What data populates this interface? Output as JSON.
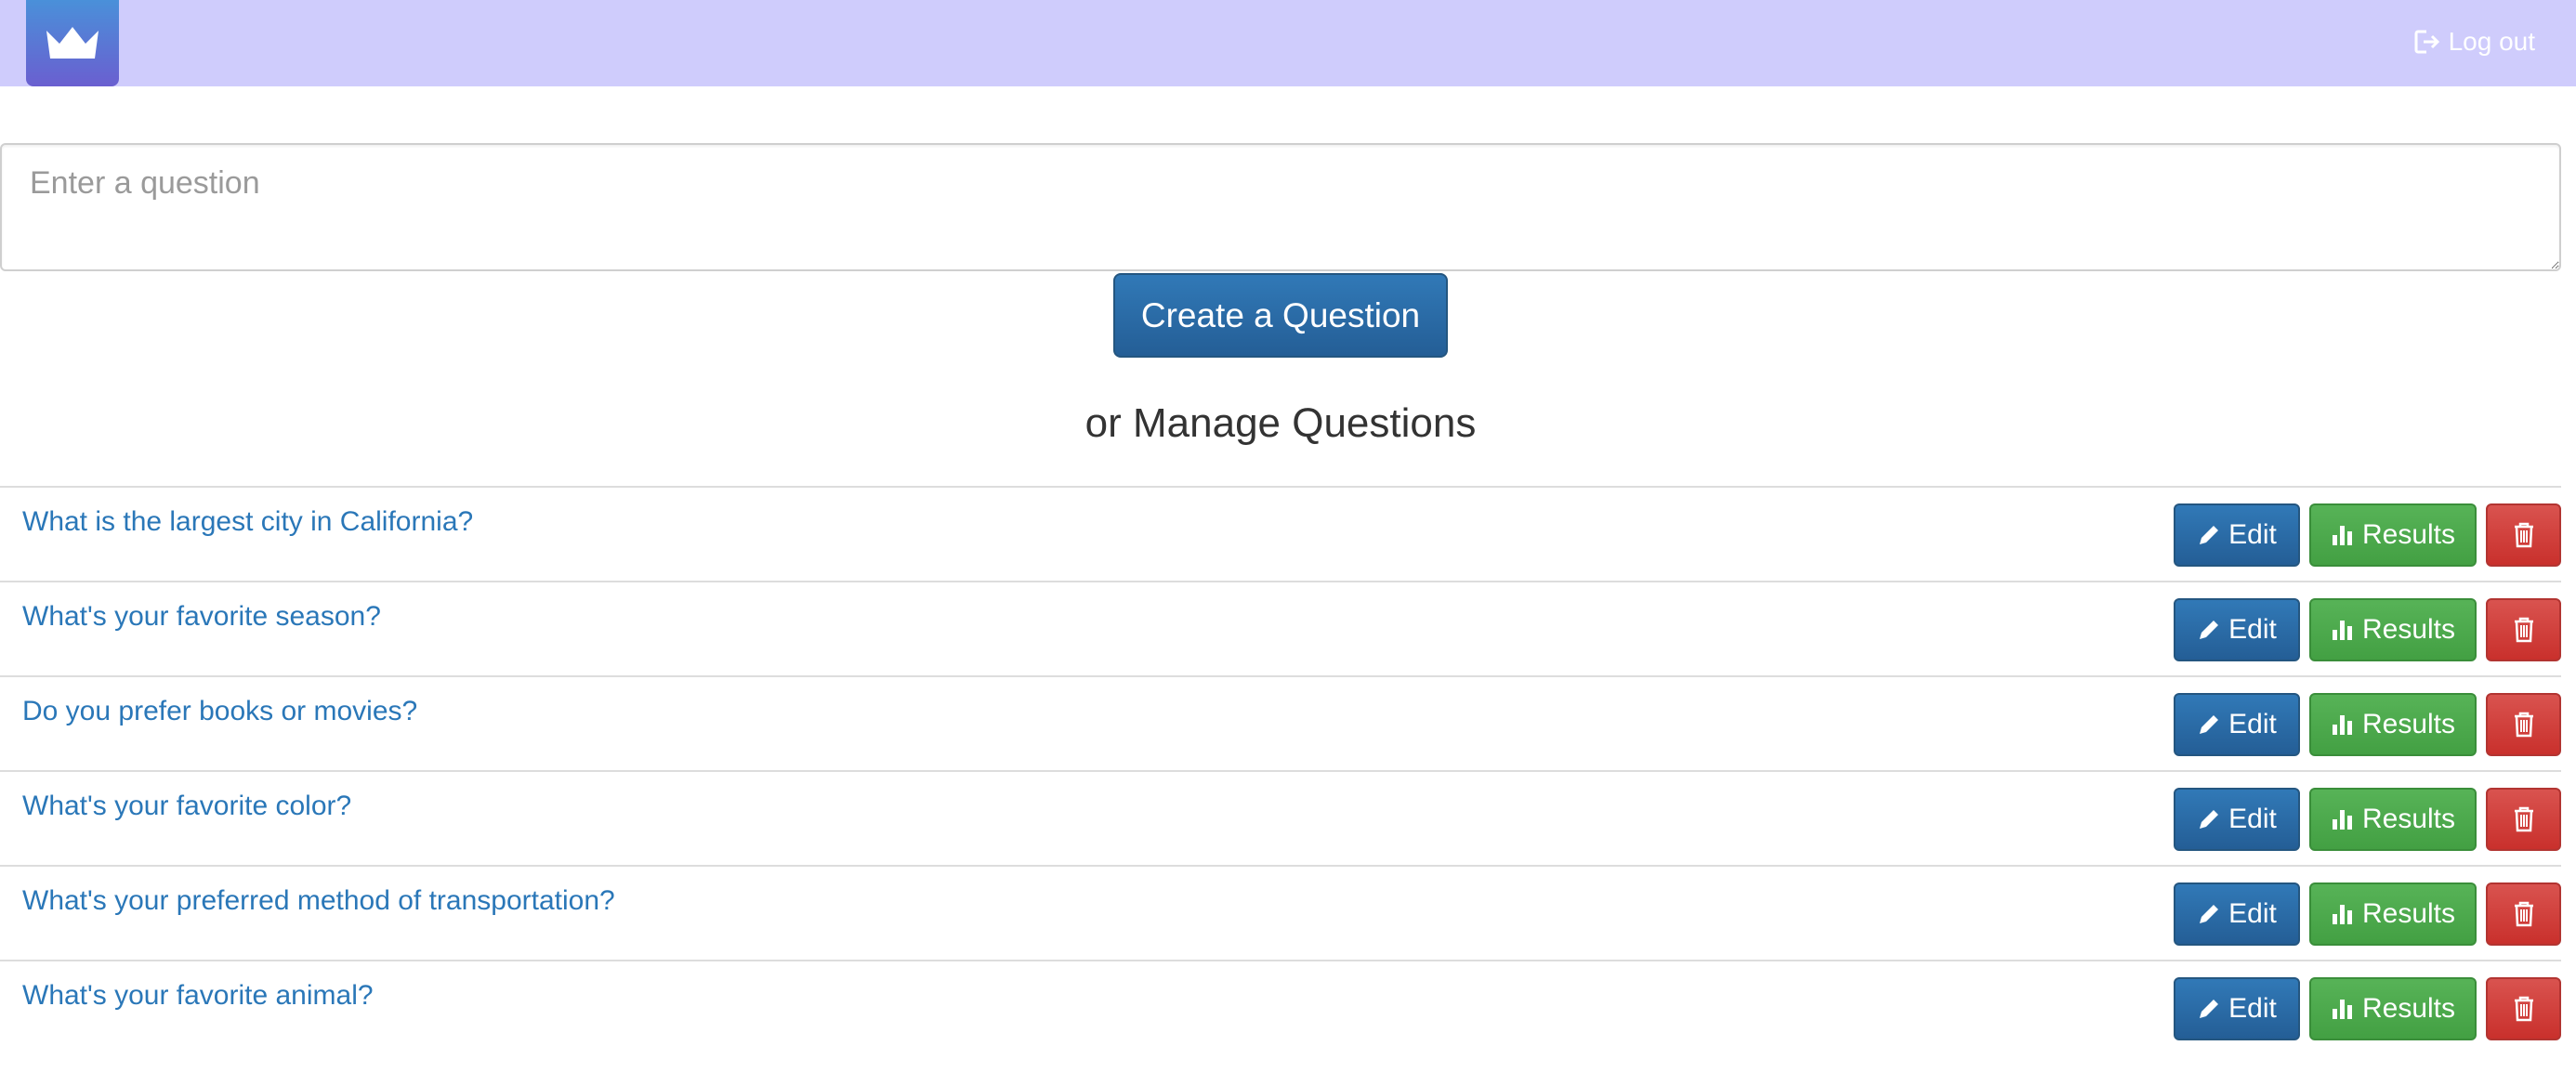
{
  "header": {
    "logo_icon": "crown-icon",
    "logout_label": "Log out",
    "logout_icon": "log-out-icon",
    "background_color": "#cfccfc"
  },
  "new_question": {
    "placeholder": "Enter a question",
    "value": "",
    "create_label": "Create a Question"
  },
  "manage": {
    "heading": "or Manage Questions"
  },
  "questions": [
    {
      "text": "What is the largest city in California?"
    },
    {
      "text": "What's your favorite season?"
    },
    {
      "text": "Do you prefer books or movies?"
    },
    {
      "text": "What's your favorite color?"
    },
    {
      "text": "What's your preferred method of transportation?"
    },
    {
      "text": "What's your favorite animal?"
    }
  ],
  "row_actions": {
    "edit_label": "Edit",
    "edit_icon": "pencil-icon",
    "results_label": "Results",
    "results_icon": "bar-chart-icon",
    "delete_icon": "trash-icon"
  },
  "colors": {
    "primary": "#2a6ba5",
    "success": "#4cae4c",
    "danger": "#d9534f",
    "link": "#2a77b8"
  }
}
